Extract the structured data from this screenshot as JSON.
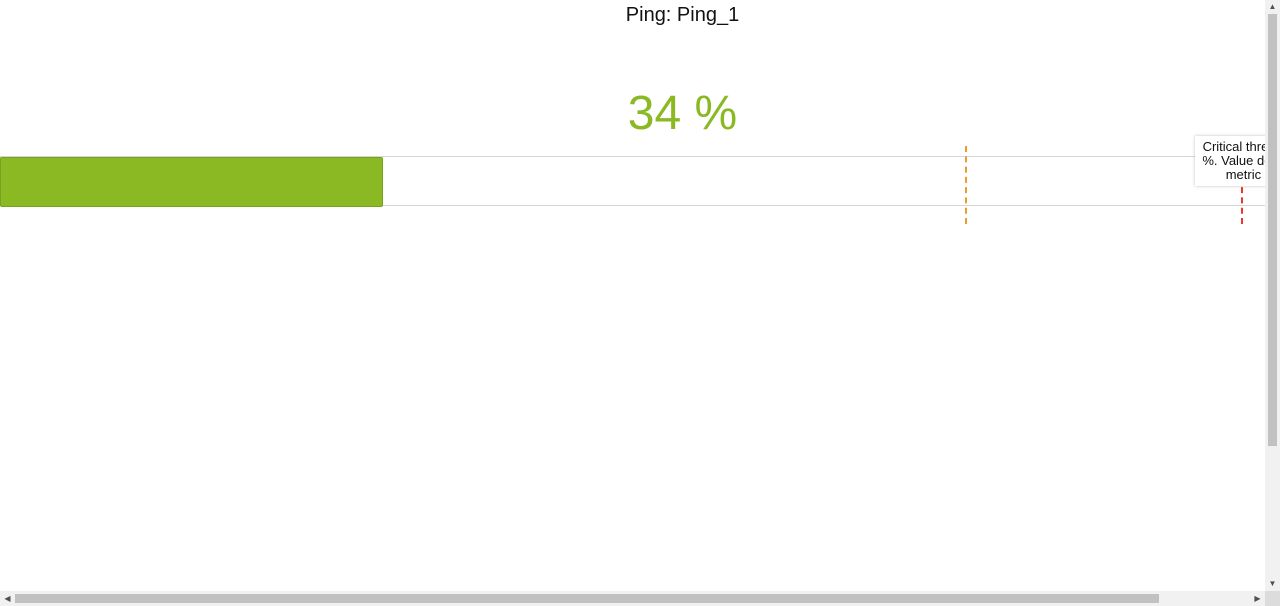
{
  "widget": {
    "title": "Ping: Ping_1",
    "value_text": "34 %",
    "value_fraction": 0.34,
    "accent_color": "#8ab924",
    "warning_color": "#ef9a2c",
    "critical_color": "#e8392e",
    "tooltip_text": "Critical threshold %. Value defined metric Pi"
  },
  "icons": {
    "scroll_up": "▲",
    "scroll_down": "▼",
    "scroll_left": "◀",
    "scroll_right": "▶"
  }
}
